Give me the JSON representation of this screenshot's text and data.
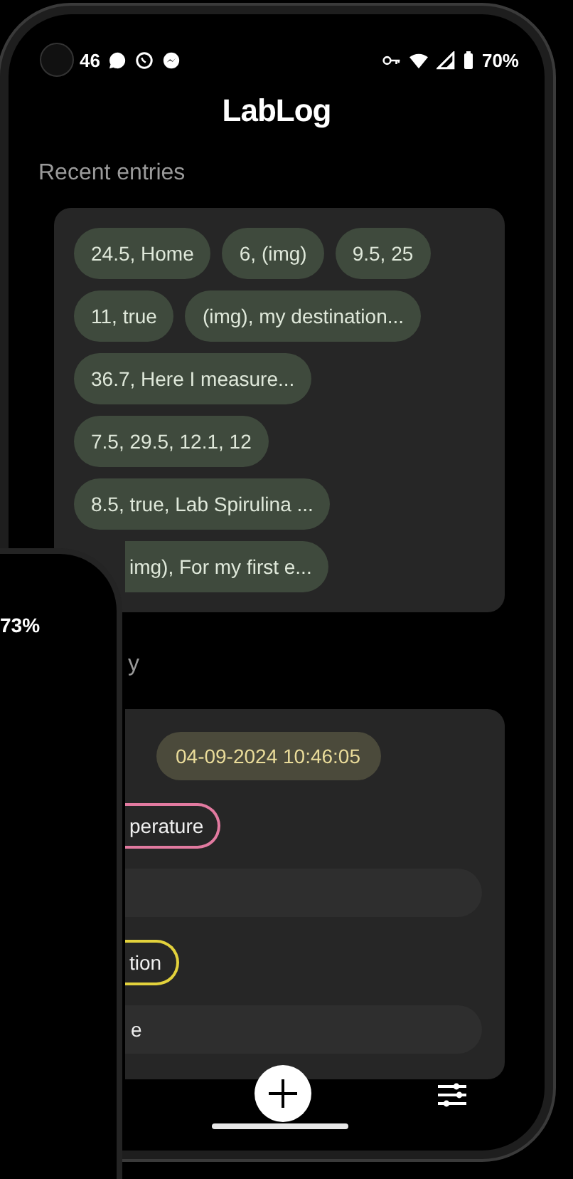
{
  "status_bar": {
    "time": "46",
    "battery": "70%"
  },
  "app_title": "LabLog",
  "recent": {
    "title": "Recent entries",
    "entries": [
      {
        "kind": "chip",
        "text": "24.5, Home"
      },
      {
        "kind": "chip",
        "text": "6, (img)"
      },
      {
        "kind": "chip",
        "text": "9.5, 25"
      },
      {
        "kind": "chip",
        "text": "11, true"
      },
      {
        "kind": "chip",
        "text": "(img), my destination..."
      },
      {
        "kind": "chip",
        "text": "36.7, Here I measure..."
      },
      {
        "kind": "chip",
        "text": "7.5, 29.5, 12.1, 12"
      },
      {
        "kind": "chip",
        "text": "8.5, true, Lab Spirulina ..."
      },
      {
        "kind": "cut_chip",
        "text": "img), For my first e..."
      }
    ]
  },
  "entry": {
    "title": "y",
    "timestamp": "04-09-2024 10:46:05",
    "rows": [
      {
        "kind": "tag",
        "text": "perature",
        "color": "#e27aa0"
      },
      {
        "kind": "field"
      },
      {
        "kind": "tag",
        "text": "tion",
        "color": "#e3d23c"
      },
      {
        "kind": "field",
        "value": "e"
      }
    ]
  },
  "second_phone": {
    "battery": "73%"
  }
}
